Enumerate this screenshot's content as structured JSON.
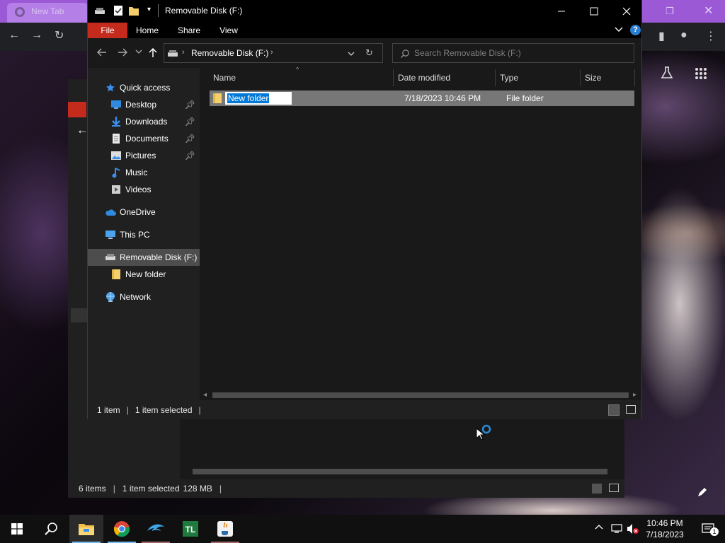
{
  "window": {
    "title": "Removable Disk (F:)",
    "ribbon_tabs": [
      "File",
      "Home",
      "Share",
      "View"
    ]
  },
  "address": {
    "path": "Removable Disk (F:)"
  },
  "search": {
    "placeholder": "Search Removable Disk (F:)"
  },
  "navigation": {
    "quick_access": "Quick access",
    "desktop": "Desktop",
    "downloads": "Downloads",
    "documents": "Documents",
    "pictures": "Pictures",
    "music": "Music",
    "videos": "Videos",
    "onedrive": "OneDrive",
    "this_pc": "This PC",
    "removable_disk": "Removable Disk (F:)",
    "new_folder": "New folder",
    "network": "Network"
  },
  "columns": {
    "name": "Name",
    "date_modified": "Date modified",
    "type": "Type",
    "size": "Size"
  },
  "files": [
    {
      "name": "New folder",
      "date_modified": "7/18/2023 10:46 PM",
      "type": "File folder",
      "size": ""
    }
  ],
  "status": {
    "item_count": "1 item",
    "selected": "1 item selected"
  },
  "background_window": {
    "item_count": "6 items",
    "selected": "1 item selected",
    "size": "128 MB"
  },
  "browser_tab": {
    "title": "New Tab"
  },
  "taskbar": {
    "time": "10:46 PM",
    "date": "7/18/2023",
    "notification_count": "1",
    "pinned_apps": [
      "file-explorer",
      "chrome",
      "dolphin-emulator",
      "tlauncher",
      "java"
    ]
  },
  "colors": {
    "accent": "#0078d7",
    "file_tab": "#c42b1c",
    "browser_tab_strip": "#9b59d6"
  }
}
